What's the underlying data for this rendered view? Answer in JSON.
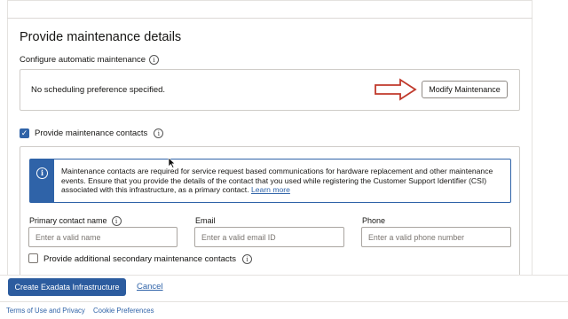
{
  "section": {
    "title": "Provide maintenance details",
    "auto_maintenance_label": "Configure automatic maintenance",
    "schedule_status": "No scheduling preference specified.",
    "modify_button": "Modify Maintenance",
    "annotation_arrow_color": "#c0392b"
  },
  "contacts": {
    "checkbox_label": "Provide maintenance contacts",
    "checkbox_checked": true,
    "info_banner": {
      "text": "Maintenance contacts are required for service request based communications for hardware replacement and other maintenance events. Ensure that you provide the details of the contact that you used while registering the Customer Support Identifier (CSI) associated with this infrastructure, as a primary contact.",
      "link": "Learn more",
      "icon": "info-icon"
    },
    "fields": {
      "primary_name_label": "Primary contact name",
      "primary_name_placeholder": "Enter a valid name",
      "email_label": "Email",
      "email_placeholder": "Enter a valid email ID",
      "phone_label": "Phone",
      "phone_placeholder": "Enter a valid phone number"
    },
    "secondary_label": "Provide additional secondary maintenance contacts",
    "secondary_checked": false
  },
  "actions": {
    "create_button": "Create Exadata Infrastructure",
    "cancel_link": "Cancel"
  },
  "footer": {
    "terms": "Terms of Use and Privacy",
    "cookies": "Cookie Preferences"
  },
  "colors": {
    "accent": "#2f63a8",
    "primary_button": "#2c5c9f"
  }
}
